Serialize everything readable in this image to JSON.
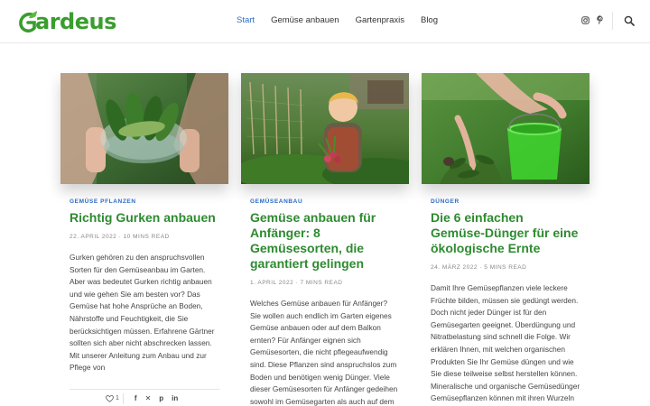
{
  "header": {
    "logo_text": "ardeus",
    "nav": [
      "Start",
      "Gemüse anbauen",
      "Gartenpraxis",
      "Blog"
    ],
    "social_icons": [
      "instagram-icon",
      "pinterest-icon"
    ],
    "search_icon": "search-icon"
  },
  "colors": {
    "brand_green": "#3a9d2f",
    "title_green": "#2e8b30",
    "accent_blue": "#2c6cc9"
  },
  "cards": [
    {
      "category": "GEMÜSE PFLANZEN",
      "title": "Richtig Gurken anbauen",
      "meta": "22. APRIL 2022 · 10 MINS READ",
      "excerpt": "Gurken gehören zu den anspruchsvollen Sorten für den Gemüseanbau im Garten. Aber was bedeutet Gurken richtig anbauen und wie gehen Sie am besten vor? Das Gemüse hat hohe Ansprüche an Boden, Nährstoffe und Feuchtigkeit, die Sie berücksichtigen müssen. Erfahrene Gärtner sollten sich aber nicht abschrecken lassen. Mit unserer Anleitung zum Anbau und zur Pflege von",
      "likes": "1"
    },
    {
      "category": "GEMÜSEANBAU",
      "title": "Gemüse anbauen für Anfänger: 8 Gemüsesorten, die garantiert gelingen",
      "meta": "1. APRIL 2022 · 7 MINS READ",
      "excerpt": "Welches Gemüse anbauen für Anfänger? Sie wollen auch endlich im Garten eigenes Gemüse anbauen oder auf dem Balkon ernten? Für Anfänger eignen sich Gemüsesorten, die nicht pflegeaufwendig sind. Diese Pflanzen sind anspruchslos zum Boden und benötigen wenig Dünger. Viele dieser Gemüsesorten für Anfänger gedeihen sowohl im Gemüsegarten als auch auf dem Balkon. Dank einfacher Aussaat,"
    },
    {
      "category": "DÜNGER",
      "title": "Die 6 einfachen Gemüse-Dünger für eine ökologische Ernte",
      "meta": "24. MÄRZ 2022 · 5 MINS READ",
      "excerpt": "Damit Ihre Gemüsepflanzen viele leckere Früchte bilden, müssen sie gedüngt werden. Doch nicht jeder Dünger ist für den Gemüsegarten geeignet. Überdüngung und Nitratbelastung sind schnell die Folge. Wir erklären Ihnen, mit welchen organischen Produkten Sie Ihr Gemüse düngen und wie Sie diese teilweise selbst herstellen können. Mineralische und organische Gemüsedünger Gemüsepflanzen können mit ihren Wurzeln"
    }
  ]
}
